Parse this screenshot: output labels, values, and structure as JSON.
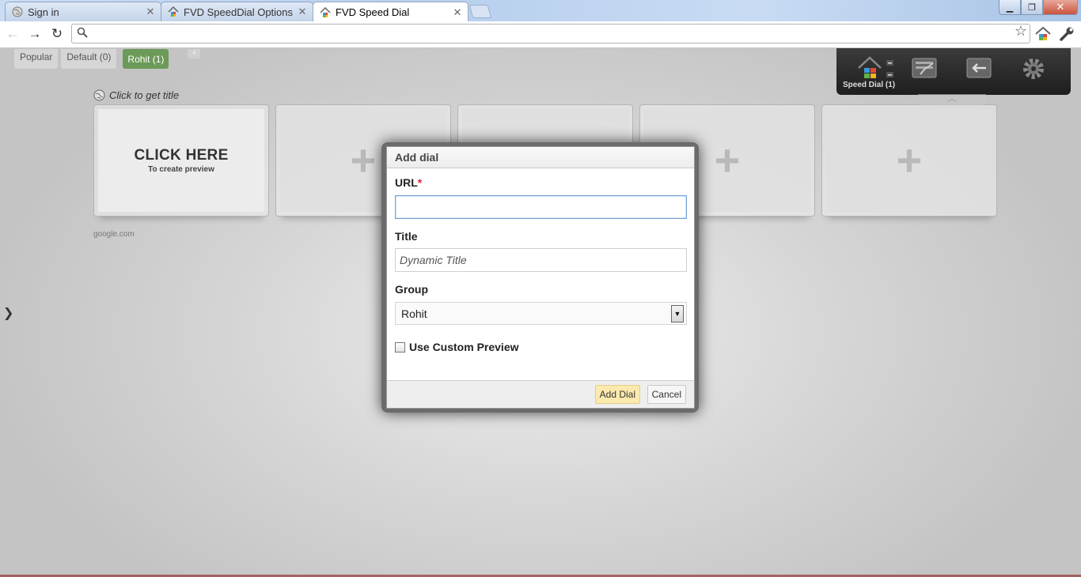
{
  "browser": {
    "tabs": [
      {
        "title": "Sign in",
        "icon": "globe-icon",
        "active": false
      },
      {
        "title": "FVD SpeedDial Options",
        "icon": "speeddial-house-icon",
        "active": false
      },
      {
        "title": "FVD Speed Dial",
        "icon": "speeddial-house-icon",
        "active": true
      }
    ],
    "window_controls": {
      "minimize": "▁",
      "maximize": "❐",
      "close": "✕"
    },
    "nav": {
      "back": "←",
      "forward": "→",
      "reload": "↻"
    },
    "omnibox": {
      "value": "",
      "placeholder": ""
    },
    "star_glyph": "☆"
  },
  "page": {
    "groups": [
      {
        "label": "Popular",
        "active": false
      },
      {
        "label": "Default (0)",
        "active": false
      },
      {
        "label": "Rohit (1)",
        "active": true
      }
    ],
    "group_add": "+",
    "dial_title": "Click to get title",
    "first_dial": {
      "headline": "CLICK HERE",
      "subline": "To create preview",
      "url": "google.com"
    },
    "plus_glyph": "+",
    "side_arrow": "❯"
  },
  "panel": {
    "label": "Speed Dial (1)"
  },
  "dialog": {
    "title": "Add dial",
    "url_label": "URL",
    "required_mark": "*",
    "url_value": "",
    "title_label": "Title",
    "title_placeholder": "Dynamic Title",
    "group_label": "Group",
    "group_value": "Rohit",
    "group_arrow": "▼",
    "custom_preview_label": "Use Custom Preview",
    "custom_preview_checked": false,
    "add_button": "Add Dial",
    "cancel_button": "Cancel"
  },
  "colors": {
    "active_group": "#6c9a58",
    "primary_button": "#fbe9ad",
    "focus_border": "#6f9fd4",
    "required": "#dd2233"
  }
}
